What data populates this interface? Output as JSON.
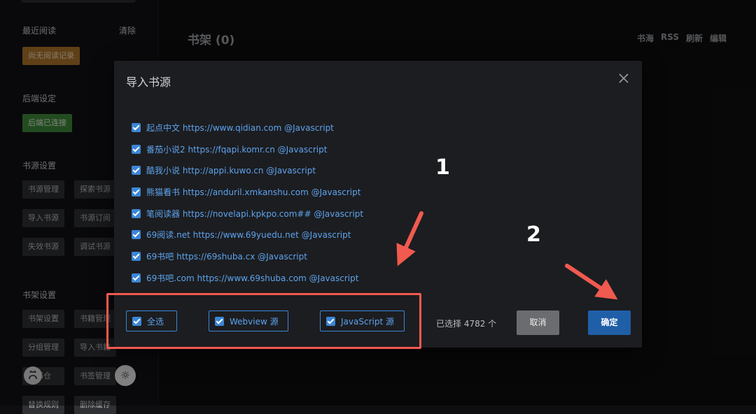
{
  "sidebar": {
    "recent_title": "最近阅读",
    "clear_label": "清除",
    "recent_empty": "尚无阅读记录",
    "backend_title": "后端设定",
    "backend_selected": "后端已连接",
    "source_settings_title": "书源设置",
    "source_buttons": [
      "书源管理",
      "探索书源",
      "导入书源",
      "书源订阅",
      "失效书源",
      "调试书源"
    ],
    "shelf_settings_title": "书架设置",
    "shelf_buttons": [
      "书架设置",
      "书籍管理",
      "分组管理",
      "导入书籍",
      "书仓",
      "书签管理",
      "替换规则",
      "删除缓存"
    ]
  },
  "shelf": {
    "title": "书架 (0)",
    "links": [
      "书海",
      "RSS",
      "刷新",
      "编辑"
    ]
  },
  "dialog": {
    "title": "导入书源",
    "sources": [
      "起点中文 https://www.qidian.com @Javascript",
      "番茄小说2 https://fqapi.komr.cn @Javascript",
      "酷我小说 http://appi.kuwo.cn @Javascript",
      "熊猫看书 https://anduril.xmkanshu.com @Javascript",
      "笔阅读器 https://novelapi.kpkpo.com## @Javascript",
      "69阅读.net https://www.69yuedu.net @Javascript",
      "69书吧 https://69shuba.cx @Javascript",
      "69书吧.com https://www.69shuba.com @Javascript"
    ],
    "options": {
      "select_all": "全选",
      "webview": "Webview 源",
      "javascript": "JavaScript 源"
    },
    "selected_count": "已选择 4782 个",
    "cancel_label": "取消",
    "confirm_label": "确定"
  },
  "annotations": {
    "label_1": "1",
    "label_2": "2",
    "color": "#f05a4f"
  },
  "colors": {
    "accent_blue": "#3b86d6",
    "link_blue": "#5da3ee",
    "confirm_blue": "#1f5fa8"
  }
}
